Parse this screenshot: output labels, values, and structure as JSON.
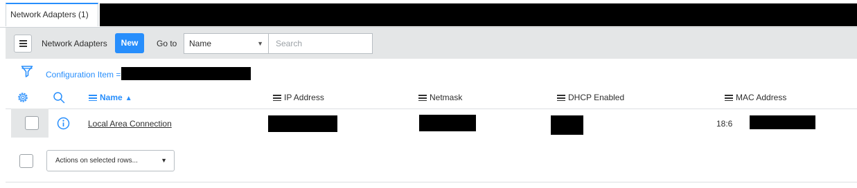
{
  "tab": {
    "label": "Network Adapters (1)"
  },
  "header": {
    "list_title": "Network Adapters",
    "new_label": "New",
    "goto_label": "Go to",
    "field_selected": "Name",
    "search_placeholder": "Search"
  },
  "filter": {
    "breadcrumb": "Configuration Item ="
  },
  "columns": [
    {
      "label": "Name",
      "sorted": "ascending"
    },
    {
      "label": "IP Address"
    },
    {
      "label": "Netmask"
    },
    {
      "label": "DHCP Enabled"
    },
    {
      "label": "MAC Address"
    }
  ],
  "rows": [
    {
      "name": "Local Area Connection",
      "mac_address_visible": "18:6"
    }
  ],
  "footer": {
    "actions_label": "Actions on selected rows..."
  },
  "icons": {
    "menu": "hamburger-icon",
    "filter": "funnel-icon",
    "settings": "gear-icon",
    "search": "magnifier-icon",
    "info": "info-circle-icon",
    "sort": "triangle-up-icon",
    "dropdown": "triangle-down-icon"
  },
  "colors": {
    "accent": "#278efc",
    "header_bg": "#e4e6e7",
    "text": "#2e2e2e"
  }
}
